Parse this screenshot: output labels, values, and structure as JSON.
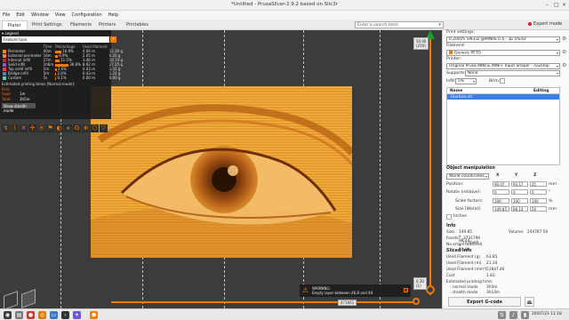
{
  "window": {
    "title": "*Untitled - PrusaSlicer-2.9.2 based on Slic3r"
  },
  "menu": [
    "File",
    "Edit",
    "Window",
    "View",
    "Configuration",
    "Help"
  ],
  "tabs": [
    "Plater",
    "Print Settings",
    "Filaments",
    "Printers",
    "Printables"
  ],
  "search": {
    "placeholder": "Enter a search term"
  },
  "mode": {
    "label": "Expert mode"
  },
  "legend": {
    "title": "Legend",
    "feature_type": "Feature type",
    "headers": [
      "",
      "Time",
      "Percentage",
      "Used filament"
    ],
    "rows": [
      {
        "name": "Perimeter",
        "time": "40m",
        "pct": "16.9%",
        "len": "4.04 m",
        "g": "12.20 g",
        "color": "#f08c00",
        "fraction": 0.169
      },
      {
        "name": "External perimeter",
        "time": "16m",
        "pct": "6.9%",
        "len": "2.05 m",
        "g": "6.20 g",
        "color": "#ff7d38",
        "fraction": 0.069
      },
      {
        "name": "Internal infill",
        "time": "27m",
        "pct": "11.5%",
        "len": "3.46 m",
        "g": "10.74 g",
        "color": "#b03029",
        "fraction": 0.115
      },
      {
        "name": "Solid infill",
        "time": "1h6m",
        "pct": "36.8%",
        "len": "8.92 m",
        "g": "27.25 g",
        "color": "#9654cc",
        "fraction": 0.368
      },
      {
        "name": "Top solid infill",
        "time": "1m",
        "pct": "3.6%",
        "len": "0.43 m",
        "g": "1.31 g",
        "color": "#f04040",
        "fraction": 0.036
      },
      {
        "name": "Bridge infill",
        "time": "5m",
        "pct": "2.4%",
        "len": "0.43 m",
        "g": "1.31 g",
        "color": "#4d80ba",
        "fraction": 0.024
      },
      {
        "name": "Custom",
        "time": "5s",
        "pct": "0.1%",
        "len": "0.00 m",
        "g": "0.00 g",
        "color": "#5ed194",
        "fraction": 0.001
      }
    ],
    "est_title": "Estimated printing times [Normal mode]:",
    "first_layer_label": "First layer:",
    "first_layer": "1m",
    "total_label": "Total:",
    "total": "3h5m",
    "stealth_button": "Show stealth mode"
  },
  "viewport": {
    "top_layer_label": "50.00",
    "top_layer_index": "(250)",
    "bottom_layer_label": "0.20",
    "bottom_layer_index": "(1)",
    "h_slider_label": "471661"
  },
  "warning": {
    "title": "WARNING:",
    "text": "Empty layer between 46.8 and 49."
  },
  "right": {
    "print_settings_label": "Print settings:",
    "print_profile": "0.20mm SPEED @MINIIS 0.4 - 3p 5%rec",
    "filament_label": "Filament:",
    "filament": "Generic PETG",
    "printer_label": "Printer:",
    "printer": "Original Prusa MINI & MINI+ Input Shaper - noZHop",
    "supports_label": "Supports:",
    "supports": "None",
    "infill_label": "Infill:",
    "infill": "5%",
    "brim_label": "Brim:",
    "list_headers": [
      "Name",
      "Editing"
    ],
    "objects": [
      "1Surface.stl"
    ],
    "obj_manip": "Object manipulation",
    "coord_system": "World coordinates",
    "axes": [
      "X",
      "Y",
      "Z"
    ],
    "position_label": "Position:",
    "position": [
      "90.07",
      "93.17",
      "25"
    ],
    "rotation_label": "Rotate (relative):",
    "rotation": [
      "0",
      "0",
      "0"
    ],
    "scale_label": "Scale factors:",
    "scale": [
      "100",
      "100",
      "100"
    ],
    "size_label": "Size [World]:",
    "size": [
      "149.85",
      "98.14",
      "50"
    ],
    "units": [
      "mm",
      "°",
      "%",
      "mm"
    ],
    "inches_label": "Inches",
    "info_title": "Info",
    "info": [
      {
        "k": "Size:",
        "v": "149.85 x 98.14 x 50.00"
      },
      {
        "k": "Volume:",
        "v": "244787.56"
      },
      {
        "k": "Facets:",
        "v": "2731796 (1 shell)"
      },
      {
        "k": "No errors detected",
        "v": ""
      }
    ],
    "sliced_title": "Sliced Info",
    "sliced": [
      {
        "k": "Used Filament (g)",
        "v": "63.85"
      },
      {
        "k": "Used Filament (m)",
        "v": "21.34"
      },
      {
        "k": "Used Filament (mm³)",
        "v": "51847.46"
      },
      {
        "k": "Cost",
        "v": "1.83"
      },
      {
        "k": "Estimated printing time:",
        "v": ""
      },
      {
        "k": "- normal mode",
        "v": "3h5m"
      },
      {
        "k": "- stealth mode",
        "v": "3h14m"
      }
    ],
    "export_button": "Export G-code"
  },
  "taskbar": {
    "clock": "20/07/23 11:18"
  },
  "colors": {
    "accent": "#f07b00",
    "selection": "#3d7ee0",
    "viewport_bg": "#3c3c3c",
    "green": "#16a02c"
  }
}
